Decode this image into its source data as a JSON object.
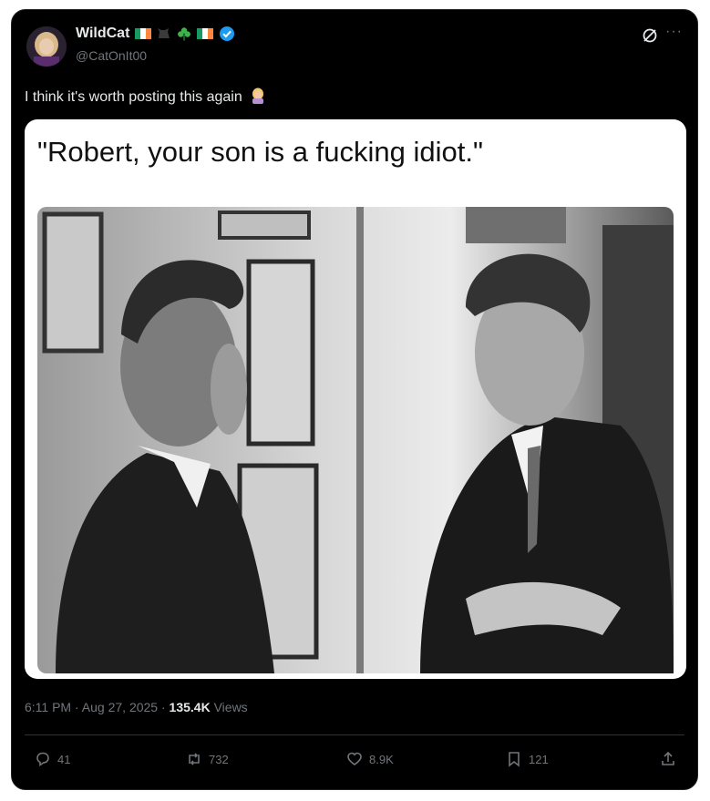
{
  "post": {
    "display_name": "WildCat",
    "handle": "@CatOnIt00",
    "text": "I think it's worth posting this again",
    "emoji_name": "woman-facepalming-emoji",
    "meme_caption": "\"Robert, your son is a fucking idiot.\"",
    "time": "6:11 PM",
    "date": "Aug 27, 2025",
    "views_count": "135.4K",
    "views_label": "Views"
  },
  "actions": {
    "replies": "41",
    "reposts": "732",
    "likes": "8.9K",
    "bookmarks": "121"
  },
  "colors": {
    "background": "#000000",
    "primary_text": "#e7e9ea",
    "secondary_text": "#71767b",
    "verified": "#1d9bf0",
    "divider": "#2f3336"
  },
  "icons": [
    "grok-icon",
    "more-icon",
    "verified-badge-icon",
    "reply-icon",
    "repost-icon",
    "like-icon",
    "bookmark-icon",
    "share-icon"
  ]
}
